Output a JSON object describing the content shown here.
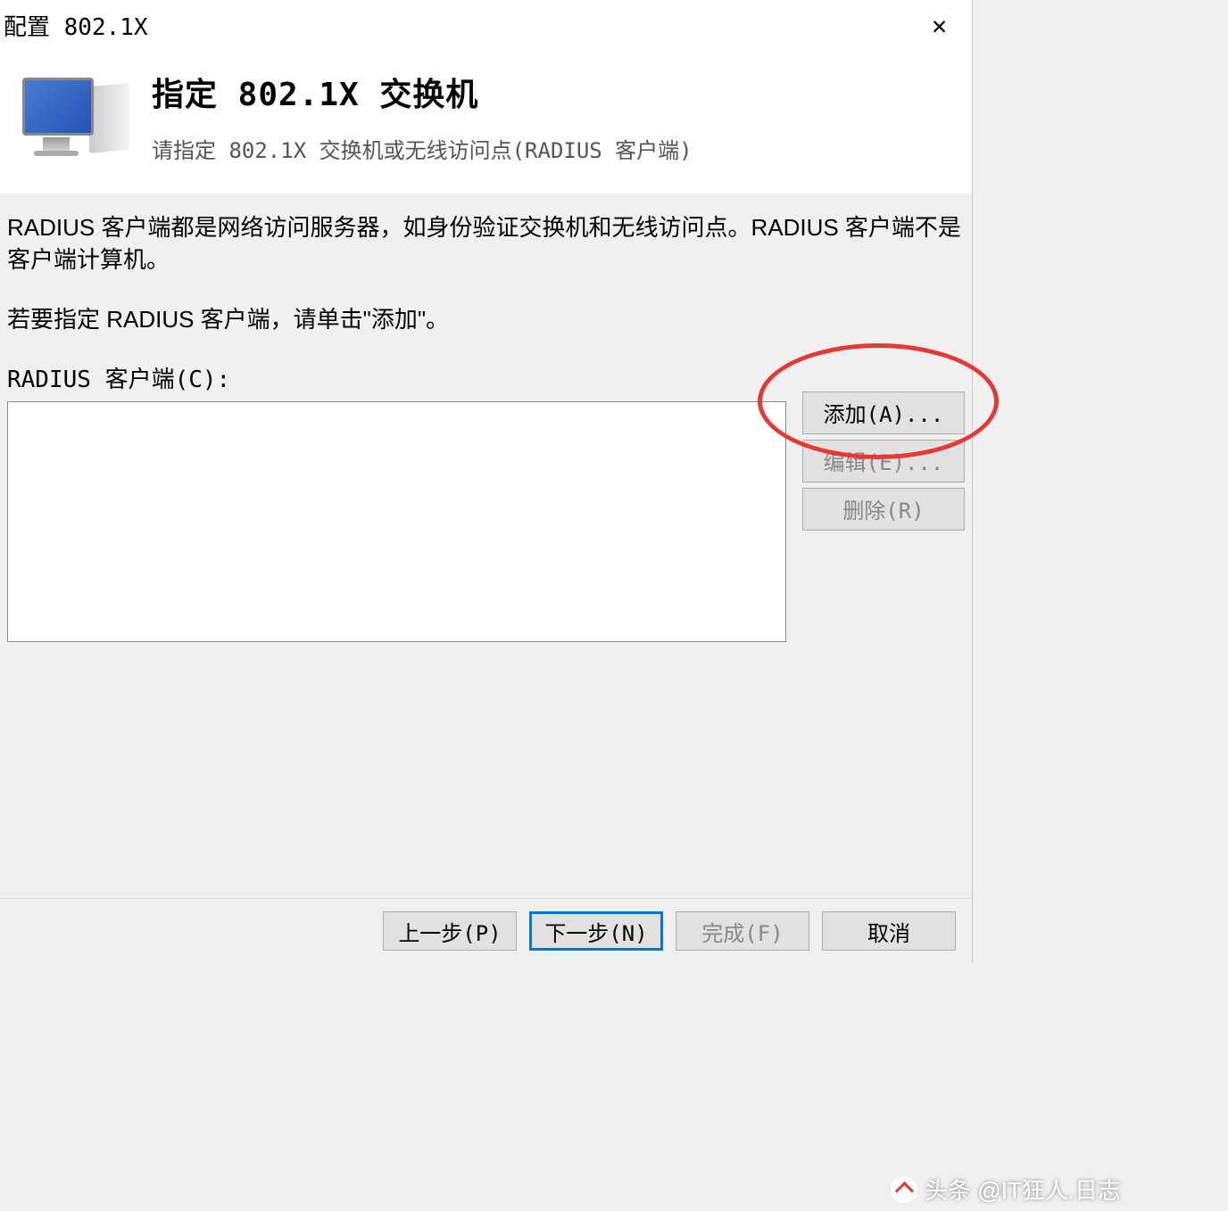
{
  "titlebar": {
    "title": "配置 802.1X"
  },
  "header": {
    "title": "指定 802.1X 交换机",
    "subtitle": "请指定 802.1X 交换机或无线访问点(RADIUS 客户端)"
  },
  "body": {
    "description": "RADIUS 客户端都是网络访问服务器，如身份验证交换机和无线访问点。RADIUS 客户端不是客户端计算机。",
    "instruction": "若要指定 RADIUS 客户端，请单击\"添加\"。",
    "list_label": "RADIUS 客户端(C):",
    "list_items": []
  },
  "side_buttons": {
    "add": "添加(A)...",
    "edit": "编辑(E)...",
    "remove": "删除(R)"
  },
  "footer_buttons": {
    "previous": "上一步(P)",
    "next": "下一步(N)",
    "finish": "完成(F)",
    "cancel": "取消"
  },
  "watermark": "头条 @IT狂人.日志"
}
